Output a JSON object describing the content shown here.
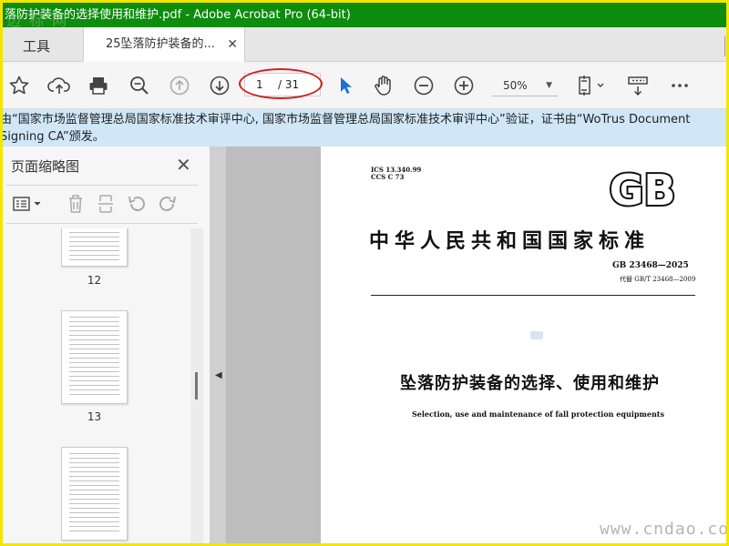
{
  "window": {
    "title": "落防护装备的选择使用和维护.pdf - Adobe Acrobat Pro (64-bit)",
    "watermark_top_left": "边 标 网"
  },
  "tabs": {
    "tools_label": "工具",
    "doc_label": "25坠落防护装备的...",
    "close_glyph": "✕"
  },
  "toolbar": {
    "page_current": "1",
    "page_total": "/ 31",
    "zoom": "50%",
    "icons": [
      "star-icon",
      "cloud-upload-icon",
      "print-icon",
      "zoom-search-icon",
      "arrow-up-icon",
      "arrow-down-icon",
      "select-cursor-icon",
      "hand-icon",
      "zoom-out-icon",
      "zoom-in-icon",
      "fit-page-icon",
      "read-mode-icon",
      "more-icon"
    ],
    "highlight_color": "#d42020"
  },
  "notice": {
    "line1": "由“国家市场监督管理总局国家标准技术审评中心, 国家市场监督管理总局国家标准技术审评中心”验证，证书由“WoTrus Document",
    "line2": "Signing CA”颁发。"
  },
  "sidebar": {
    "title": "页面缩略图",
    "close_glyph": "✕",
    "thumbnails": [
      {
        "label": "12"
      },
      {
        "label": "13"
      },
      {
        "label": ""
      }
    ]
  },
  "document": {
    "ics": "ICS 13.340.99",
    "ccs": "CCS C 73",
    "logo_text": "GB",
    "national_standard": "中华人民共和国国家标准",
    "standard_no": "GB 23468—2025",
    "replaces": "代替 GB/T 23468—2009",
    "title_cn": "坠落防护装备的选择、使用和维护",
    "title_en": "Selection, use and maintenance of fall protection equipments"
  },
  "watermark_bottom_right": "www.cndao.com",
  "colors": {
    "titlebar": "#0d8c0d",
    "frame": "#f2e600",
    "notice_bg": "#cfe7f7",
    "cursor_blue": "#1f6fd1"
  }
}
